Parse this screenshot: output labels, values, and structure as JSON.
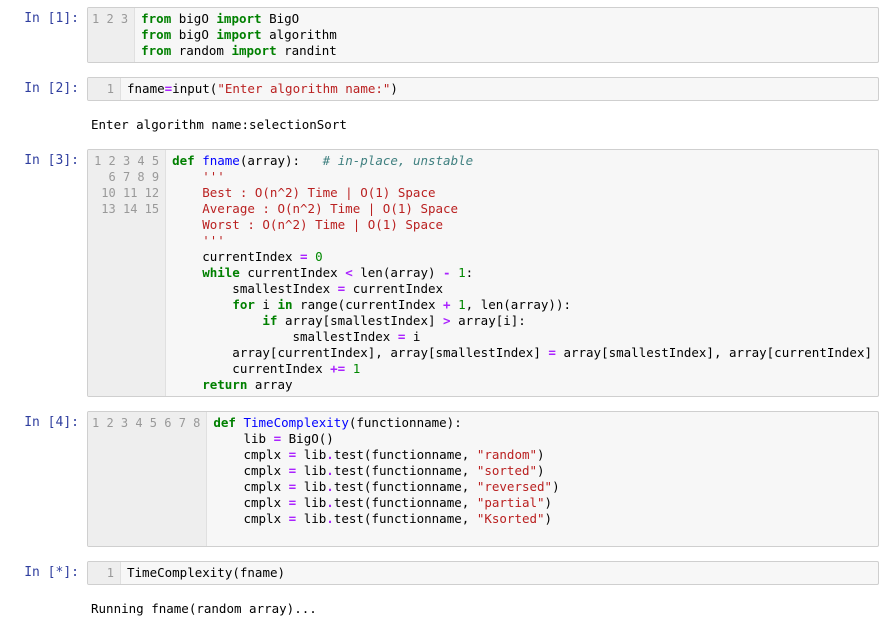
{
  "cells": [
    {
      "prompt": "In [1]:",
      "lines": [
        "1",
        "2",
        "3"
      ],
      "code_html": "<span class='kw'>from</span> bigO <span class='kw'>import</span> BigO\n<span class='kw'>from</span> bigO <span class='kw'>import</span> algorithm\n<span class='kw'>from</span> random <span class='kw'>import</span> randint"
    },
    {
      "prompt": "In [2]:",
      "lines": [
        "1"
      ],
      "code_html": "fname<span class='op'>=</span>input(<span class='str'>\"Enter algorithm name:\"</span>)",
      "output": "Enter algorithm name:selectionSort"
    },
    {
      "prompt": "In [3]:",
      "lines": [
        "1",
        "2",
        "3",
        "4",
        "5",
        "6",
        "7",
        "8",
        "9",
        "10",
        "11",
        "12",
        "13",
        "14",
        "15"
      ],
      "code_html": "<span class='kw'>def</span> <span class='def'>fname</span>(array):   <span class='cmt'># in-place, unstable</span>\n    <span class='str'>'''</span>\n<span class='str'>    Best : O(n^2) Time | O(1) Space</span>\n<span class='str'>    Average : O(n^2) Time | O(1) Space</span>\n<span class='str'>    Worst : O(n^2) Time | O(1) Space</span>\n<span class='str'>    '''</span>\n    currentIndex <span class='op'>=</span> <span class='num'>0</span>\n    <span class='kw'>while</span> currentIndex <span class='op'>&lt;</span> len(array) <span class='op'>-</span> <span class='num'>1</span>:\n        smallestIndex <span class='op'>=</span> currentIndex\n        <span class='kw'>for</span> i <span class='kw'>in</span> range(currentIndex <span class='op'>+</span> <span class='num'>1</span>, len(array)):\n            <span class='kw'>if</span> array[smallestIndex] <span class='op'>&gt;</span> array[i]:\n                smallestIndex <span class='op'>=</span> i\n        array[currentIndex], array[smallestIndex] <span class='op'>=</span> array[smallestIndex], array[currentIndex]\n        currentIndex <span class='op'>+=</span> <span class='num'>1</span>\n    <span class='kw'>return</span> array"
    },
    {
      "prompt": "In [4]:",
      "lines": [
        "1",
        "2",
        "3",
        "4",
        "5",
        "6",
        "7",
        "8"
      ],
      "code_html": "<span class='kw'>def</span> <span class='def'>TimeComplexity</span>(functionname):\n    lib <span class='op'>=</span> BigO()\n    cmplx <span class='op'>=</span> lib<span class='op'>.</span>test(functionname, <span class='str'>\"random\"</span>)\n    cmplx <span class='op'>=</span> lib<span class='op'>.</span>test(functionname, <span class='str'>\"sorted\"</span>)\n    cmplx <span class='op'>=</span> lib<span class='op'>.</span>test(functionname, <span class='str'>\"reversed\"</span>)\n    cmplx <span class='op'>=</span> lib<span class='op'>.</span>test(functionname, <span class='str'>\"partial\"</span>)\n    cmplx <span class='op'>=</span> lib<span class='op'>.</span>test(functionname, <span class='str'>\"Ksorted\"</span>)\n    "
    },
    {
      "prompt": "In [*]:",
      "lines": [
        "1"
      ],
      "code_html": "TimeComplexity(fname)",
      "output": "Running fname(random array)..."
    }
  ]
}
